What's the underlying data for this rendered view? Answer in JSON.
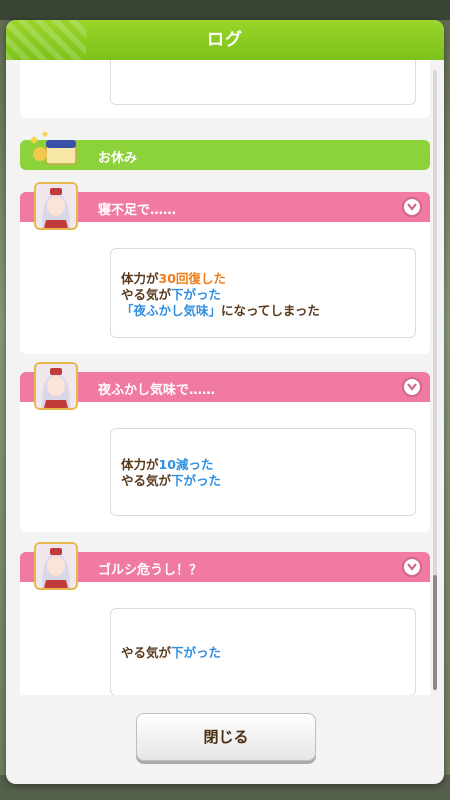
{
  "header": {
    "title": "ログ"
  },
  "rest": {
    "label": "お休み"
  },
  "events": [
    {
      "title": "寝不足で……",
      "lines": [
        {
          "prefix": "体力が",
          "highlight": "30回復した",
          "suffix": ""
        },
        {
          "prefix": "やる気が",
          "highlight": "下がった",
          "suffix": ""
        },
        {
          "prefix": "",
          "highlight": "「夜ふかし気味」",
          "suffix": "になってしまった"
        }
      ]
    },
    {
      "title": "夜ふかし気味で……",
      "lines": [
        {
          "prefix": "体力が",
          "highlight": "10減った",
          "suffix": ""
        },
        {
          "prefix": "やる気が",
          "highlight": "下がった",
          "suffix": ""
        }
      ]
    },
    {
      "title": "ゴルシ危うし！？",
      "lines": [
        {
          "prefix": "やる気が",
          "highlight": "下がった",
          "suffix": ""
        }
      ]
    }
  ],
  "footer": {
    "close_label": "閉じる"
  },
  "colors": {
    "header_green": "#7cc21b",
    "event_pink": "#f07aa0",
    "rest_green": "#8cd23a",
    "increase_orange": "#ef7d1a",
    "decrease_blue": "#2f8fe0"
  }
}
